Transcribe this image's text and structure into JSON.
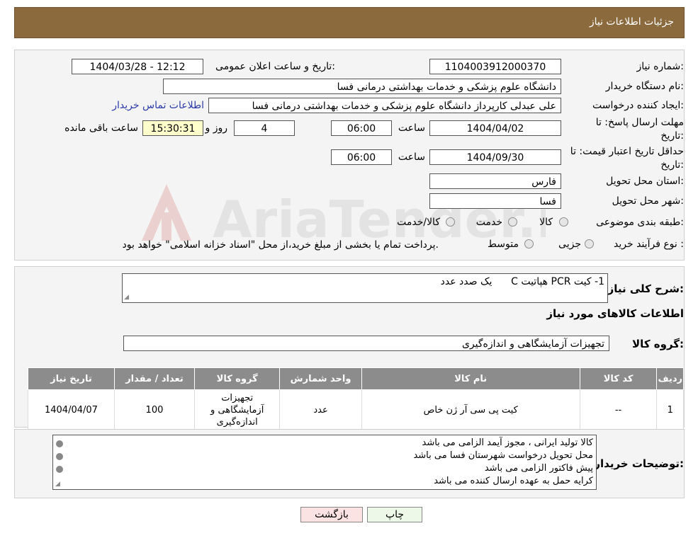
{
  "header": {
    "title": "جزئیات اطلاعات نیاز"
  },
  "form": {
    "need_number_label": "شماره نیاز:",
    "need_number": "1104003912000370",
    "announce_label": "تاریخ و ساعت اعلان عمومی:",
    "announce_value": "1404/03/28 - 12:12",
    "buyer_org_label": "نام دستگاه خریدار:",
    "buyer_org": "دانشگاه علوم پزشکی و خدمات بهداشتی درمانی فسا",
    "creator_label": "ایجاد کننده درخواست:",
    "creator": "علی عبدلی کارپرداز دانشگاه علوم پزشکی و خدمات بهداشتی درمانی فسا",
    "contact_link": "اطلاعات تماس خریدار",
    "deadline_label_1": "مهلت ارسال پاسخ: تا",
    "deadline_label_2": "تاریخ:",
    "deadline_date": "1404/04/02",
    "time_label": "ساعت",
    "deadline_time": "06:00",
    "days_value": "4",
    "days_label": "روز و",
    "remaining_time": "15:30:31",
    "remaining_label": "ساعت باقی مانده",
    "validity_label_1": "حداقل تاریخ اعتبار قیمت: تا",
    "validity_label_2": "تاریخ:",
    "validity_date": "1404/09/30",
    "validity_time": "06:00",
    "province_label": "استان محل تحویل:",
    "province": "فارس",
    "city_label": "شهر محل تحویل:",
    "city": "فسا",
    "category_label": "طبقه بندی موضوعی:",
    "category_options": [
      "کالا",
      "خدمت",
      "کالا/خدمت"
    ],
    "process_label": "نوع فرآیند خرید :",
    "process_options": [
      "جزیی",
      "متوسط"
    ],
    "process_note": "پرداخت تمام یا بخشی از مبلغ خرید،از محل \"اسناد خزانه اسلامی\" خواهد بود."
  },
  "description": {
    "label": "شرح کلی نیاز:",
    "value": "1- کیت PCR هپاتیت C      یک صدد عدد"
  },
  "items_section": {
    "title": "اطلاعات کالاهای مورد نیاز",
    "group_label": "گروه کالا:",
    "group_value": "تجهیزات آزمایشگاهی و اندازه‌گیری",
    "columns": [
      "ردیف",
      "کد کالا",
      "نام کالا",
      "واحد شمارش",
      "گروه کالا",
      "تعداد / مقدار",
      "تاریخ نیاز"
    ],
    "rows": [
      {
        "row": "1",
        "code": "--",
        "name": "کیت پی سی آر ژن خاص",
        "unit": "عدد",
        "group": "تجهیزات آزمایشگاهی و اندازه‌گیری",
        "qty": "100",
        "date": "1404/04/07"
      }
    ]
  },
  "buyer_notes": {
    "label": "توضیحات خریدار:",
    "lines": [
      "کالا تولید ایرانی ، مجوز آیمد الزامی می باشد",
      "محل تحویل درخواست شهرستان فسا می باشد",
      "پیش فاکتور الزامی می باشد",
      "کرایه حمل به عهده ارسال کننده می باشد"
    ]
  },
  "buttons": {
    "print": "چاپ",
    "back": "بازگشت"
  },
  "watermark_text": "AriaTender.neT",
  "colors": {
    "header": "#8b6a3e",
    "table_header": "#8c8c8c",
    "highlight": "#ffffcc",
    "link": "#2b3aa8"
  }
}
